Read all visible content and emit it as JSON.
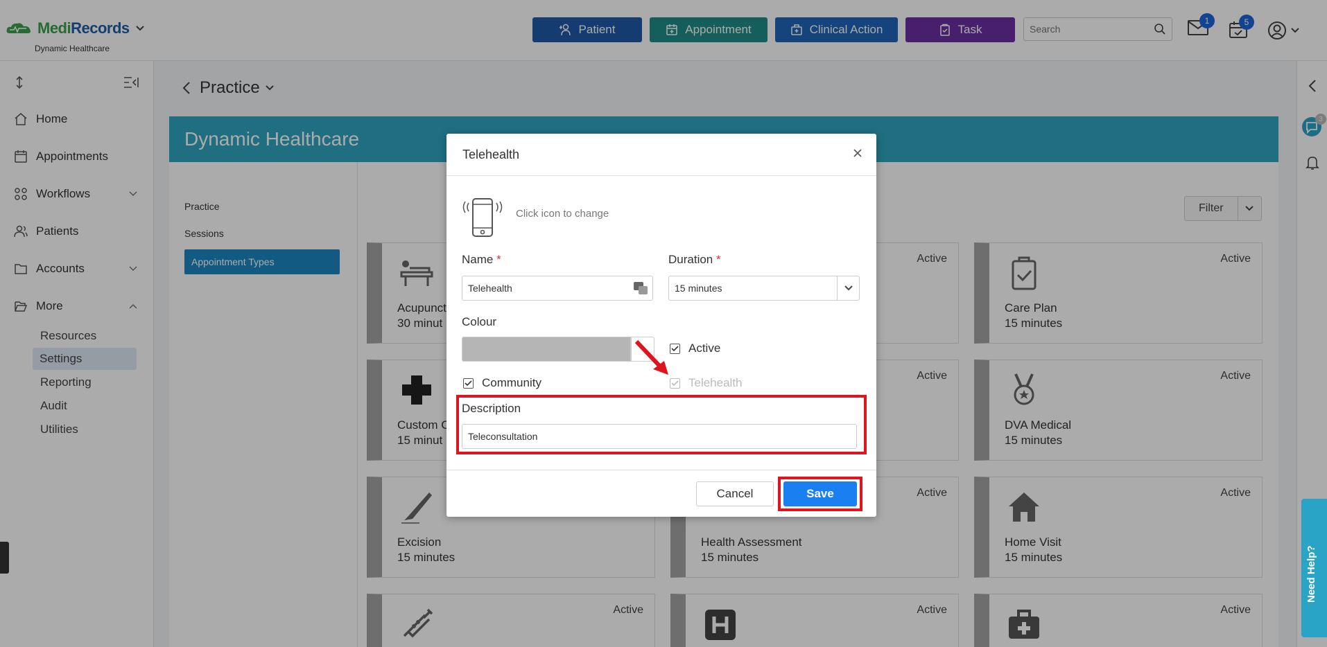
{
  "header": {
    "brand_part1": "Medi",
    "brand_part2": "Records",
    "practice_name": "Dynamic Healthcare",
    "buttons": {
      "patient": "Patient",
      "appointment": "Appointment",
      "clinical_action": "Clinical Action",
      "task": "Task"
    },
    "search": {
      "placeholder": "Search"
    },
    "mail_badge": "1",
    "calendar_badge": "5"
  },
  "sidebar": {
    "items": [
      {
        "label": "Home"
      },
      {
        "label": "Appointments"
      },
      {
        "label": "Workflows"
      },
      {
        "label": "Patients"
      },
      {
        "label": "Accounts"
      },
      {
        "label": "More"
      }
    ],
    "more_sub": [
      "Resources",
      "Settings",
      "Reporting",
      "Audit",
      "Utilities"
    ]
  },
  "main": {
    "breadcrumb_title": "Practice",
    "banner_title": "Dynamic Healthcare",
    "tabs": [
      "Practice",
      "Sessions",
      "Appointment Types"
    ],
    "filter_label": "Filter",
    "cards": [
      {
        "name": "Acupunct",
        "duration": "30 minut",
        "status": ""
      },
      {
        "name": "",
        "duration": "",
        "status": "Active"
      },
      {
        "name": "Care Plan",
        "duration": "15 minutes",
        "status": "Active"
      },
      {
        "name": "Custom C",
        "duration": "15 minut",
        "status": ""
      },
      {
        "name": "",
        "duration": "",
        "status": "Active"
      },
      {
        "name": "DVA Medical",
        "duration": "15 minutes",
        "status": "Active"
      },
      {
        "name": "Excision",
        "duration": "15 minutes",
        "status": ""
      },
      {
        "name": "Health Assessment",
        "duration": "15 minutes",
        "status": "Active"
      },
      {
        "name": "Home Visit",
        "duration": "15 minutes",
        "status": "Active"
      },
      {
        "name": "",
        "duration": "",
        "status": "Active"
      },
      {
        "name": "",
        "duration": "",
        "status": "Active"
      },
      {
        "name": "",
        "duration": "",
        "status": "Active"
      }
    ]
  },
  "modal": {
    "title": "Telehealth",
    "icon_hint": "Click icon to change",
    "name_label": "Name",
    "name_value": "Telehealth",
    "duration_label": "Duration",
    "duration_value": "15 minutes",
    "colour_label": "Colour",
    "colour_value": "#b5b5b5",
    "active_label": "Active",
    "community_label": "Community",
    "telehealth_label": "Telehealth",
    "description_label": "Description",
    "description_value": "Teleconsultation",
    "cancel_label": "Cancel",
    "save_label": "Save"
  },
  "right_rail": {
    "chat_badge": "3",
    "need_help": "Need Help?"
  },
  "colors": {
    "highlight": "#e0141e",
    "save": "#1a7ff0",
    "banner": "#2fa6c1"
  }
}
